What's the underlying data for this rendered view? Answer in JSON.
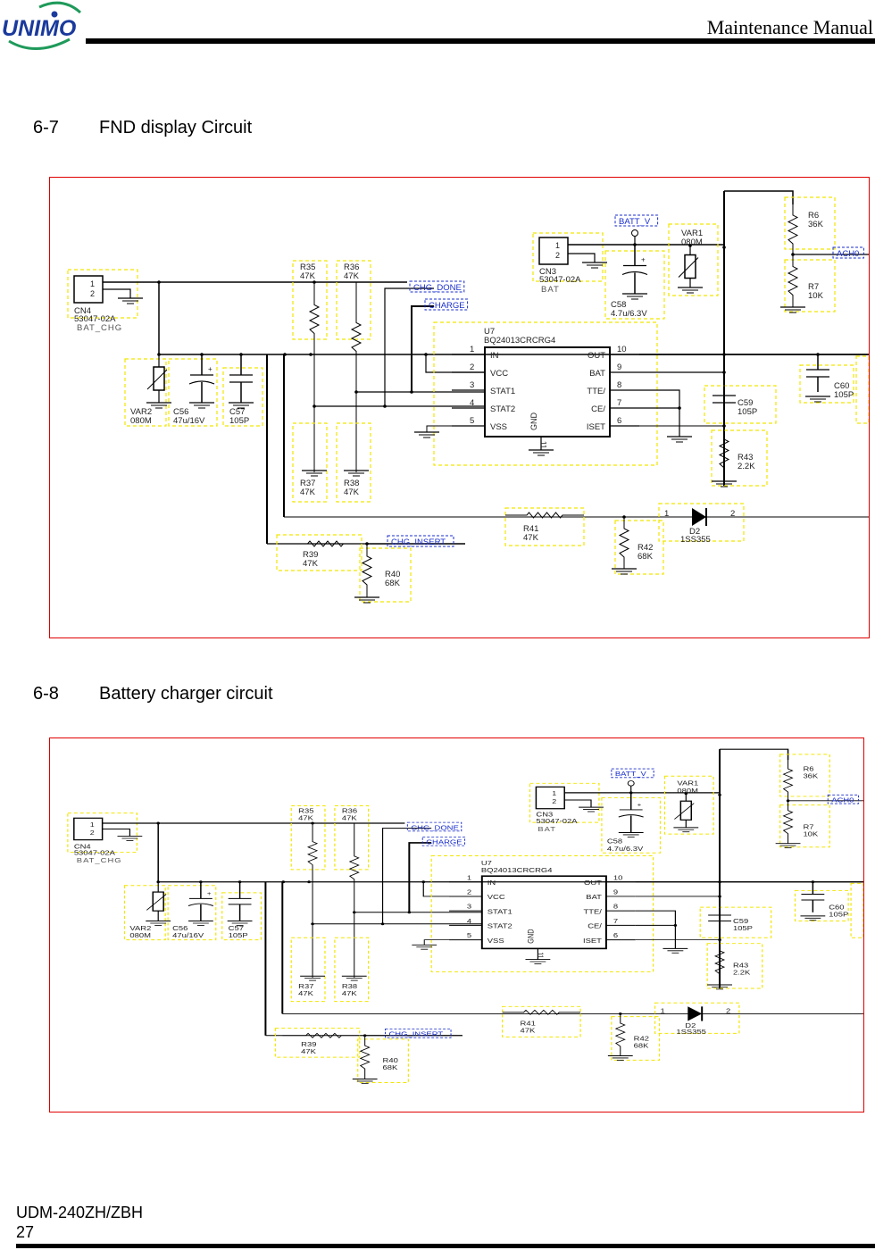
{
  "header": {
    "logo_text": "UNIMO",
    "title": "Maintenance Manual"
  },
  "sections": [
    {
      "number": "6-7",
      "title": "FND display Circuit"
    },
    {
      "number": "6-8",
      "title": "Battery charger circuit"
    }
  ],
  "schematic": {
    "ic": {
      "ref": "U7",
      "part": "BQ24013CRCRG4",
      "gnd_label": "GND",
      "gnd_pin": "11",
      "left_pins": [
        {
          "num": "1",
          "name": "IN"
        },
        {
          "num": "2",
          "name": "VCC"
        },
        {
          "num": "3",
          "name": "STAT1"
        },
        {
          "num": "4",
          "name": "STAT2"
        },
        {
          "num": "5",
          "name": "VSS"
        }
      ],
      "right_pins": [
        {
          "num": "10",
          "name": "OUT"
        },
        {
          "num": "9",
          "name": "BAT"
        },
        {
          "num": "8",
          "name": "TTE/"
        },
        {
          "num": "7",
          "name": "CE/"
        },
        {
          "num": "6",
          "name": "ISET"
        }
      ]
    },
    "connectors": {
      "cn4": {
        "ref": "CN4",
        "part": "53047-02A",
        "net": "BAT_CHG",
        "pin1": "1",
        "pin2": "2"
      },
      "cn3": {
        "ref": "CN3",
        "part": "53047-02A",
        "net": "BAT",
        "pin1": "1",
        "pin2": "2"
      }
    },
    "components": {
      "var2": {
        "ref": "VAR2",
        "value": "080M"
      },
      "var1": {
        "ref": "VAR1",
        "value": "080M"
      },
      "c56": {
        "ref": "C56",
        "value": "47u/16V"
      },
      "c57": {
        "ref": "C57",
        "value": "105P"
      },
      "c58": {
        "ref": "C58",
        "value": "4.7u/6.3V"
      },
      "c59": {
        "ref": "C59",
        "value": "105P"
      },
      "c60": {
        "ref": "C60",
        "value": "105P"
      },
      "r35": {
        "ref": "R35",
        "value": "47K"
      },
      "r36": {
        "ref": "R36",
        "value": "47K"
      },
      "r37": {
        "ref": "R37",
        "value": "47K"
      },
      "r38": {
        "ref": "R38",
        "value": "47K"
      },
      "r39": {
        "ref": "R39",
        "value": "47K"
      },
      "r40": {
        "ref": "R40",
        "value": "68K"
      },
      "r41": {
        "ref": "R41",
        "value": "47K"
      },
      "r42": {
        "ref": "R42",
        "value": "68K"
      },
      "r43": {
        "ref": "R43",
        "value": "2.2K"
      },
      "r6": {
        "ref": "R6",
        "value": "36K"
      },
      "r7": {
        "ref": "R7",
        "value": "10K"
      },
      "d2": {
        "ref": "D2",
        "value": "1SS355",
        "pin1": "1",
        "pin2": "2"
      }
    },
    "nets": {
      "chg_done": "CHG_DONE",
      "charge": "CHARGE",
      "chg_insert": "CHG_INSERT",
      "batt_v": "BATT_V",
      "ach0": "ACH0"
    }
  },
  "footer": {
    "model": "UDM-240ZH/ZBH",
    "page": "27"
  },
  "colors": {
    "logo_blue": "#1a3a9c",
    "logo_green": "#1f9a5a",
    "frame_red": "#e00000",
    "box_yellow": "#f2e600",
    "net_blue": "#1a2ecc"
  }
}
